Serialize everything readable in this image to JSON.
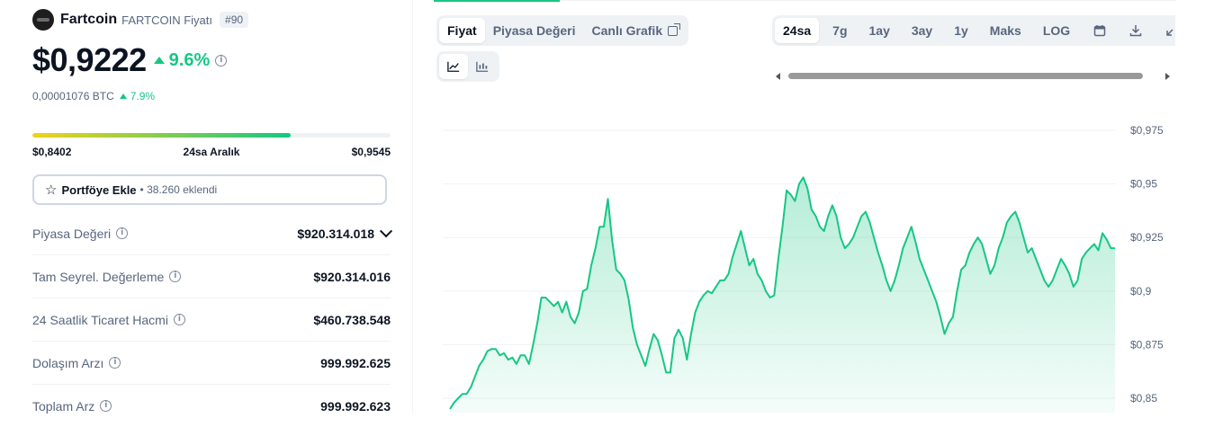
{
  "coin": {
    "name": "Fartcoin",
    "symbol_label": "FARTCOIN Fiyatı",
    "rank": "#90",
    "price": "$0,9222",
    "change_24h": "9.6%",
    "btc_price": "0,00001076 BTC",
    "btc_change": "7.9%"
  },
  "range": {
    "low": "$0,8402",
    "label": "24sa Aralık",
    "high": "$0,9545",
    "position": 0.72
  },
  "portfolio": {
    "label": "Portföye Ekle",
    "added": "38.260 eklendi"
  },
  "stats": [
    {
      "label": "Piyasa Değeri",
      "value": "$920.314.018"
    },
    {
      "label": "Tam Seyrel. Değerleme",
      "value": "$920.314.016"
    },
    {
      "label": "24 Saatlik Ticaret Hacmi",
      "value": "$460.738.548"
    },
    {
      "label": "Dolaşım Arzı",
      "value": "999.992.625"
    },
    {
      "label": "Toplam Arz",
      "value": "999.992.623"
    }
  ],
  "chart_tabs": {
    "price": "Fiyat",
    "market_cap": "Piyasa Değeri",
    "live_chart": "Canlı Grafik"
  },
  "time_ranges": [
    "24sa",
    "7g",
    "1ay",
    "3ay",
    "1y",
    "Maks",
    "LOG"
  ],
  "active_time_range": "24sa",
  "chart_types": [
    "line-chart-icon",
    "candlestick-icon"
  ],
  "colors": {
    "up": "#16c784",
    "line": "#16c784",
    "accent": "#16c784"
  },
  "chart_data": {
    "type": "area",
    "title": "",
    "xlabel": "",
    "ylabel": "",
    "ylim": [
      0.845,
      0.9795
    ],
    "y_ticks": [
      "$0,975",
      "$0,95",
      "$0,925",
      "$0,9",
      "$0,875",
      "$0,85"
    ],
    "y_tick_values": [
      0.975,
      0.95,
      0.925,
      0.9,
      0.875,
      0.85
    ],
    "series": [
      {
        "values": [
          0.845,
          0.848,
          0.85,
          0.852,
          0.852,
          0.855,
          0.86,
          0.865,
          0.868,
          0.872,
          0.873,
          0.873,
          0.87,
          0.871,
          0.868,
          0.869,
          0.866,
          0.87,
          0.87,
          0.866,
          0.875,
          0.885,
          0.897,
          0.897,
          0.895,
          0.893,
          0.895,
          0.89,
          0.895,
          0.888,
          0.885,
          0.89,
          0.9,
          0.901,
          0.912,
          0.92,
          0.93,
          0.93,
          0.943,
          0.924,
          0.91,
          0.908,
          0.905,
          0.896,
          0.883,
          0.875,
          0.87,
          0.865,
          0.873,
          0.88,
          0.877,
          0.87,
          0.862,
          0.862,
          0.878,
          0.882,
          0.878,
          0.868,
          0.88,
          0.89,
          0.895,
          0.898,
          0.9,
          0.899,
          0.902,
          0.905,
          0.905,
          0.908,
          0.916,
          0.922,
          0.928,
          0.92,
          0.912,
          0.915,
          0.908,
          0.905,
          0.9,
          0.897,
          0.898,
          0.915,
          0.93,
          0.947,
          0.945,
          0.942,
          0.95,
          0.953,
          0.948,
          0.938,
          0.935,
          0.93,
          0.928,
          0.935,
          0.94,
          0.935,
          0.925,
          0.92,
          0.922,
          0.925,
          0.93,
          0.935,
          0.937,
          0.932,
          0.925,
          0.918,
          0.912,
          0.905,
          0.9,
          0.905,
          0.912,
          0.92,
          0.925,
          0.93,
          0.923,
          0.915,
          0.91,
          0.905,
          0.9,
          0.895,
          0.888,
          0.88,
          0.885,
          0.888,
          0.9,
          0.91,
          0.912,
          0.918,
          0.922,
          0.925,
          0.922,
          0.915,
          0.908,
          0.912,
          0.92,
          0.925,
          0.932,
          0.935,
          0.937,
          0.932,
          0.925,
          0.918,
          0.92,
          0.915,
          0.91,
          0.905,
          0.902,
          0.905,
          0.91,
          0.915,
          0.912,
          0.908,
          0.902,
          0.905,
          0.915,
          0.918,
          0.92,
          0.922,
          0.919,
          0.927,
          0.924,
          0.92,
          0.92
        ]
      }
    ]
  }
}
